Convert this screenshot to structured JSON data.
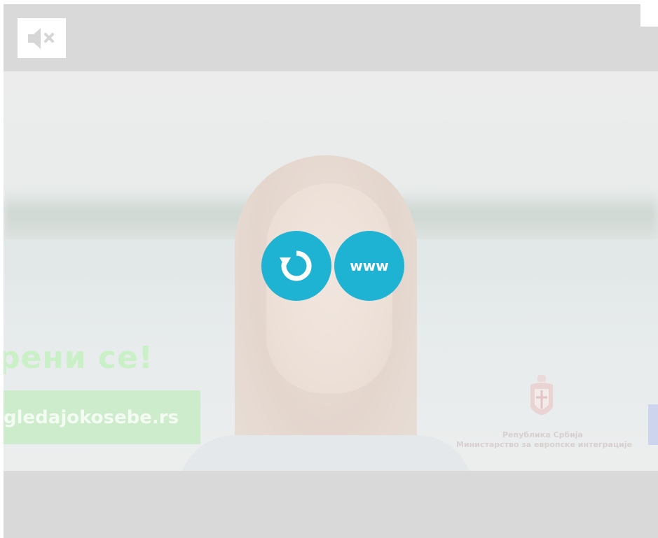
{
  "controls": {
    "mute_icon": "speaker-muted-icon",
    "replay_icon": "replay-icon",
    "www_label": "www"
  },
  "ad": {
    "heading": "рени се!",
    "url": "gledajokosebe.rs",
    "ministry_line1": "Република Србија",
    "ministry_line2": "Министарство за европске интеграције"
  },
  "colors": {
    "frame_gray": "#d9d9d9",
    "accent_blue": "#1fb3d3",
    "ad_green": "#cdeccb"
  }
}
